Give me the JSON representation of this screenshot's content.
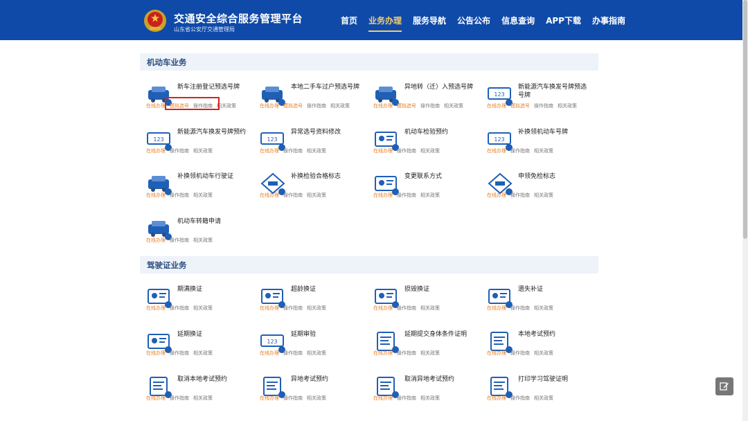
{
  "header": {
    "title": "交通安全综合服务管理平台",
    "subtitle": "山东省公安厅交通管理局",
    "nav": [
      "首页",
      "业务办理",
      "服务导航",
      "公告公布",
      "信息查询",
      "APP下载",
      "办事指南"
    ],
    "active_nav": 1
  },
  "links": {
    "online": "在线办理",
    "simulate": "模拟选号",
    "guide": "操作指南",
    "policy": "相关政策"
  },
  "sections": [
    {
      "title": "机动车业务",
      "items": [
        {
          "title": "新车注册登记预选号牌",
          "icon": "new-car-icon",
          "sim": true
        },
        {
          "title": "本地二手车过户预选号牌",
          "icon": "transfer-car-icon",
          "sim": true
        },
        {
          "title": "异地转（迁）入预选号牌",
          "icon": "migrate-car-icon",
          "sim": true
        },
        {
          "title": "新能源汽车换发号牌预选号牌",
          "icon": "ev-plate-icon",
          "sim": true
        },
        {
          "title": "新能源汽车换发号牌预约",
          "icon": "ev-appointment-icon",
          "sim": false
        },
        {
          "title": "异常选号资料修改",
          "icon": "plate-edit-icon",
          "sim": false
        },
        {
          "title": "机动车检验预约",
          "icon": "inspection-icon",
          "sim": false
        },
        {
          "title": "补换领机动车号牌",
          "icon": "plate-replace-icon",
          "sim": false
        },
        {
          "title": "补换领机动车行驶证",
          "icon": "license-card-icon",
          "sim": false
        },
        {
          "title": "补换检验合格标志",
          "icon": "inspection-badge-icon",
          "sim": false
        },
        {
          "title": "变更联系方式",
          "icon": "contact-change-icon",
          "sim": false
        },
        {
          "title": "申领免检标志",
          "icon": "exempt-badge-icon",
          "sim": false
        },
        {
          "title": "机动车转籍申请",
          "icon": "car-transfer-icon",
          "sim": false
        }
      ]
    },
    {
      "title": "驾驶证业务",
      "items": [
        {
          "title": "期满换证",
          "icon": "license-renew-icon",
          "sim": false
        },
        {
          "title": "超龄换证",
          "icon": "license-age-icon",
          "sim": false
        },
        {
          "title": "损毁换证",
          "icon": "license-damaged-icon",
          "sim": false
        },
        {
          "title": "遗失补证",
          "icon": "license-lost-icon",
          "sim": false
        },
        {
          "title": "延期换证",
          "icon": "license-extend-icon",
          "sim": false
        },
        {
          "title": "延期审验",
          "icon": "license-review-icon",
          "sim": false
        },
        {
          "title": "延期提交身体条件证明",
          "icon": "health-proof-icon",
          "sim": false
        },
        {
          "title": "本地考试预约",
          "icon": "exam-local-icon",
          "sim": false
        },
        {
          "title": "取消本地考试预约",
          "icon": "exam-cancel-icon",
          "sim": false
        },
        {
          "title": "异地考试预约",
          "icon": "exam-remote-icon",
          "sim": false
        },
        {
          "title": "取消异地考试预约",
          "icon": "exam-remote-cancel-icon",
          "sim": false
        },
        {
          "title": "打印学习驾驶证明",
          "icon": "print-proof-icon",
          "sim": false
        }
      ]
    }
  ]
}
